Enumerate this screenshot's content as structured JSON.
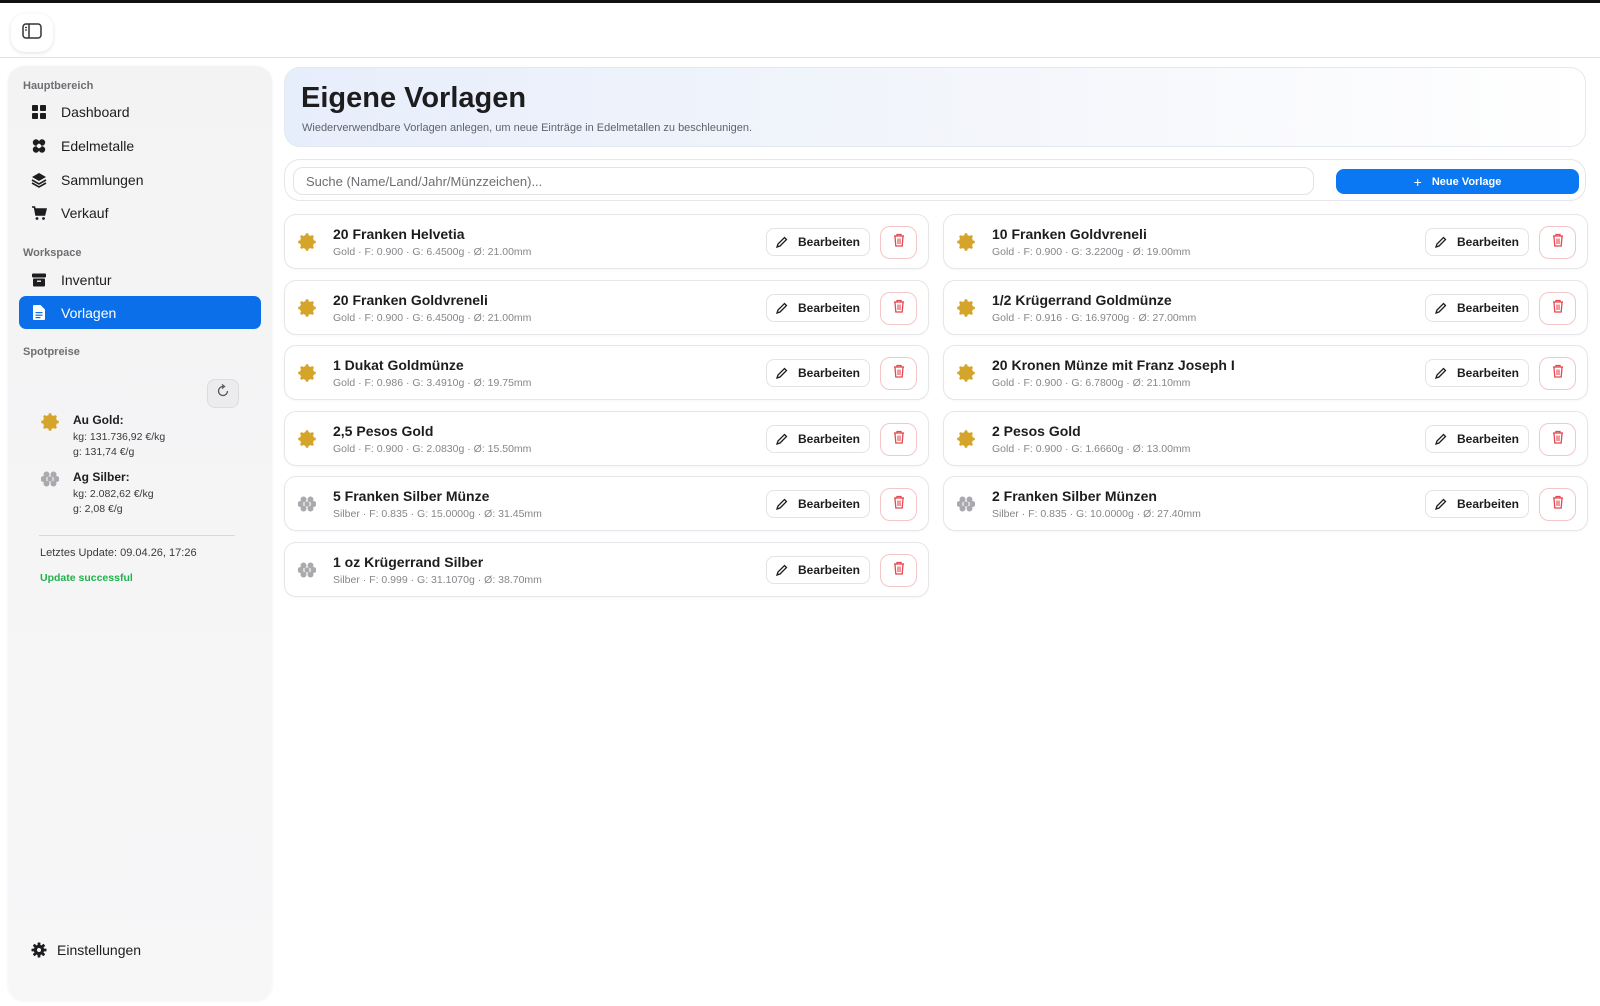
{
  "app": {
    "sidebar_toggle_icon": "sidebar-toggle-icon"
  },
  "sidebar": {
    "section_main": "Hauptbereich",
    "main_items": [
      {
        "label": "Dashboard",
        "icon": "grid-icon"
      },
      {
        "label": "Edelmetalle",
        "icon": "coins-icon"
      },
      {
        "label": "Sammlungen",
        "icon": "layers-icon"
      },
      {
        "label": "Verkauf",
        "icon": "cart-icon"
      }
    ],
    "section_workspace": "Workspace",
    "workspace_items": [
      {
        "label": "Inventur",
        "icon": "archive-icon"
      },
      {
        "label": "Vorlagen",
        "icon": "document-icon",
        "active": true
      }
    ],
    "section_spot": "Spotpreise",
    "spot_prices": [
      {
        "name": "Au Gold:",
        "kg": "kg: 131.736,92 €/kg",
        "g": "g: 131,74 €/g",
        "color": "#d4a52a"
      },
      {
        "name": "Ag Silber:",
        "kg": "kg: 2.082,62 €/kg",
        "g": "g: 2,08 €/g",
        "color": "#a9a9ae"
      }
    ],
    "last_update": "Letztes Update: 09.04.26, 17:26",
    "status": "Update successful",
    "settings_label": "Einstellungen"
  },
  "header": {
    "title": "Eigene Vorlagen",
    "subtitle": "Wiederverwendbare Vorlagen anlegen, um neue Einträge in Edelmetallen zu beschleunigen."
  },
  "toolbar": {
    "search_placeholder": "Suche (Name/Land/Jahr/Münzzeichen)...",
    "search_value": "",
    "new_button": "Neue Vorlage"
  },
  "templates": [
    {
      "title": "20 Franken Helvetia",
      "details": "Gold · F: 0.900 · G: 6.4500g · Ø: 21.00mm",
      "metal": "gold"
    },
    {
      "title": "10 Franken Goldvreneli",
      "details": "Gold · F: 0.900 · G: 3.2200g · Ø: 19.00mm",
      "metal": "gold"
    },
    {
      "title": "20 Franken Goldvreneli",
      "details": "Gold · F: 0.900 · G: 6.4500g · Ø: 21.00mm",
      "metal": "gold"
    },
    {
      "title": "1/2 Krügerrand Goldmünze",
      "details": "Gold · F: 0.916 · G: 16.9700g · Ø: 27.00mm",
      "metal": "gold"
    },
    {
      "title": "1 Dukat Goldmünze",
      "details": "Gold · F: 0.986 · G: 3.4910g · Ø: 19.75mm",
      "metal": "gold"
    },
    {
      "title": "20 Kronen Münze mit Franz Joseph I",
      "details": "Gold · F: 0.900 · G: 6.7800g · Ø: 21.10mm",
      "metal": "gold"
    },
    {
      "title": "2,5 Pesos Gold",
      "details": "Gold · F: 0.900 · G: 2.0830g · Ø: 15.50mm",
      "metal": "gold"
    },
    {
      "title": "2 Pesos Gold",
      "details": "Gold · F: 0.900 · G: 1.6660g · Ø: 13.00mm",
      "metal": "gold"
    },
    {
      "title": "5 Franken Silber Münze",
      "details": "Silber · F: 0.835 · G: 15.0000g · Ø: 31.45mm",
      "metal": "silver"
    },
    {
      "title": "2 Franken Silber Münzen",
      "details": "Silber · F: 0.835 · G: 10.0000g · Ø: 27.40mm",
      "metal": "silver"
    },
    {
      "title": "1 oz Krügerrand Silber",
      "details": "Silber · F: 0.999 · G: 31.1070g · Ø: 38.70mm",
      "metal": "silver"
    }
  ],
  "card_actions": {
    "edit_label": "Bearbeiten",
    "delete_icon": "trash-icon"
  },
  "colors": {
    "accent": "#0a78f2",
    "active_nav": "#0a6fe8",
    "gold": "#d4a52a",
    "silver": "#a9a9ae",
    "success": "#1fb14b",
    "danger": "#e5484d"
  }
}
